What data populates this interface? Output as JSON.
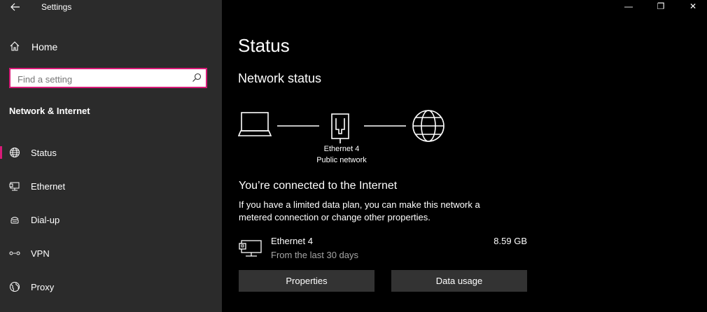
{
  "window": {
    "title": "Settings",
    "controls": {
      "minimize": "—",
      "restore": "❐",
      "close": "✕"
    }
  },
  "sidebar": {
    "home_label": "Home",
    "search": {
      "placeholder": "Find a setting",
      "value": ""
    },
    "section_heading": "Network & Internet",
    "items": [
      {
        "label": "Status",
        "icon": "globe-icon",
        "active": true
      },
      {
        "label": "Ethernet",
        "icon": "ethernet-icon",
        "active": false
      },
      {
        "label": "Dial-up",
        "icon": "dial-up-icon",
        "active": false
      },
      {
        "label": "VPN",
        "icon": "vpn-icon",
        "active": false
      },
      {
        "label": "Proxy",
        "icon": "proxy-icon",
        "active": false
      }
    ],
    "accent_color": "#d81b78"
  },
  "main": {
    "page_title": "Status",
    "network_status_heading": "Network status",
    "diagram": {
      "adapter_name": "Ethernet 4",
      "network_type": "Public network"
    },
    "connected_heading": "You’re connected to the Internet",
    "connected_description": "If you have a limited data plan, you can make this network a metered connection or change other properties.",
    "usage": {
      "name": "Ethernet 4",
      "period": "From the last 30 days",
      "amount": "8.59 GB"
    },
    "buttons": {
      "properties": "Properties",
      "data_usage": "Data usage"
    }
  }
}
